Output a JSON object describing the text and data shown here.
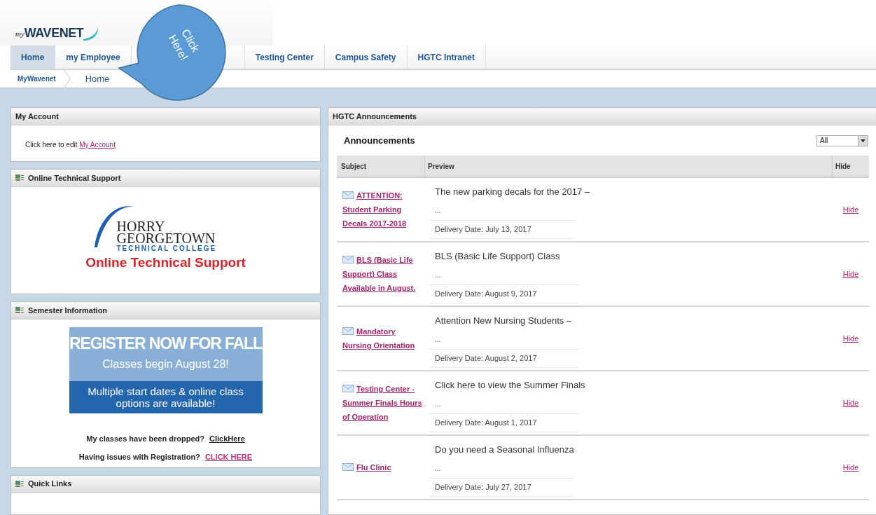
{
  "logo": {
    "prefix": "my",
    "name": "WAVENET"
  },
  "tabs": [
    {
      "label": "Home",
      "selected": true
    },
    {
      "label": "my Employee",
      "selected": false
    },
    {
      "label": "Testing Center",
      "selected": false
    },
    {
      "label": "Campus Safety",
      "selected": false
    },
    {
      "label": "HGTC Intranet",
      "selected": false
    }
  ],
  "callout": {
    "text": "Click Here!"
  },
  "breadcrumb": [
    "MyWavenet",
    "Home"
  ],
  "my_account": {
    "title": "My Account",
    "text": "Click here to edit ",
    "link": "My Account"
  },
  "tech_support": {
    "title": "Online Technical Support",
    "logo_lines": [
      "HORRY",
      "GEORGETOWN",
      "TECHNICAL COLLEGE"
    ],
    "caption": "Online Technical Support"
  },
  "semester": {
    "title": "Semester Information",
    "banner": {
      "headline": "REGISTER NOW FOR FALL",
      "sub": "Classes begin August 28!",
      "note": "Multiple start dates & online class options are available!"
    },
    "lines": [
      {
        "text": "My classes have been dropped?",
        "link": "ClickHere",
        "kind": "plain"
      },
      {
        "text": "Having issues with Registration?",
        "link": "CLICK HERE",
        "kind": "accent"
      }
    ]
  },
  "quick_links": {
    "title": "Quick Links"
  },
  "announcements": {
    "panel_title": "HGTC Announcements",
    "heading": "Announcements",
    "filter": "All",
    "columns": [
      "Subject",
      "Preview",
      "Hide"
    ],
    "rows": [
      {
        "subject": "ATTENTION: Student Parking Decals 2017-2018",
        "preview": "The new parking decals for the 2017 –",
        "more": "...",
        "date": "Delivery Date: July 13, 2017",
        "hide": "Hide"
      },
      {
        "subject": "BLS (Basic Life Support) Class Available in August.",
        "preview": "BLS (Basic Life Support) Class",
        "more": "...",
        "date": "Delivery Date: August 9, 2017",
        "hide": "Hide"
      },
      {
        "subject": "Mandatory Nursing Orientation",
        "preview": "Attention New Nursing Students –",
        "more": "...",
        "date": "Delivery Date: August 2, 2017",
        "hide": "Hide"
      },
      {
        "subject": "Testing Center - Summer Finals Hours of Operation",
        "preview": "Click here to view the Summer Finals",
        "more": "...",
        "date": "Delivery Date: August 1, 2017",
        "hide": "Hide"
      },
      {
        "subject": "Flu Clinic",
        "preview": "Do you need a Seasonal Influenza",
        "more": "...",
        "date": "Delivery Date: July 27, 2017",
        "hide": "Hide"
      }
    ]
  }
}
